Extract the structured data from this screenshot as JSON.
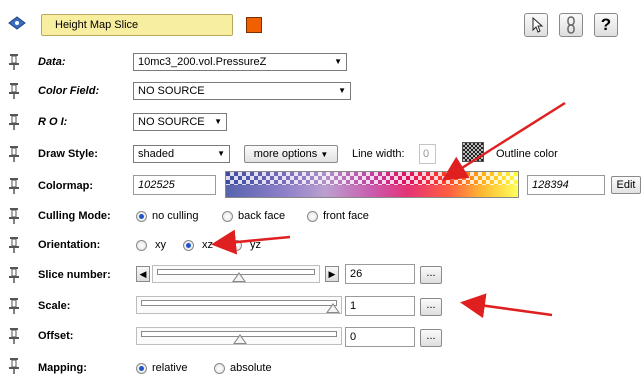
{
  "header": {
    "title": "Height Map Slice",
    "color_swatch": "#f06000",
    "title_bg": "#f8eea0",
    "help_label": "?"
  },
  "rows": {
    "data": {
      "label": "Data:",
      "value": "10mc3_200.vol.PressureZ"
    },
    "color_field": {
      "label": "Color Field:",
      "value": "NO SOURCE"
    },
    "roi": {
      "label": "R O I:",
      "value": "NO SOURCE"
    },
    "draw_style": {
      "label": "Draw Style:",
      "value": "shaded",
      "more_options": "more options",
      "line_width_label": "Line width:",
      "line_width_value": "0",
      "outline_label": "Outline color"
    },
    "colormap": {
      "label": "Colormap:",
      "min": "102525",
      "max": "128394",
      "edit": "Edit"
    },
    "culling": {
      "label": "Culling Mode:",
      "options": [
        "no culling",
        "back face",
        "front face"
      ],
      "selected": 0
    },
    "orientation": {
      "label": "Orientation:",
      "options": [
        "xy",
        "xz",
        "yz"
      ],
      "selected": 1
    },
    "slice": {
      "label": "Slice number:",
      "value": "26",
      "dots": "..."
    },
    "scale": {
      "label": "Scale:",
      "value": "1",
      "dots": "..."
    },
    "offset": {
      "label": "Offset:",
      "value": "0",
      "dots": "..."
    },
    "mapping": {
      "label": "Mapping:",
      "options": [
        "relative",
        "absolute"
      ],
      "selected": 0
    }
  },
  "annotation_color": "#e02020"
}
